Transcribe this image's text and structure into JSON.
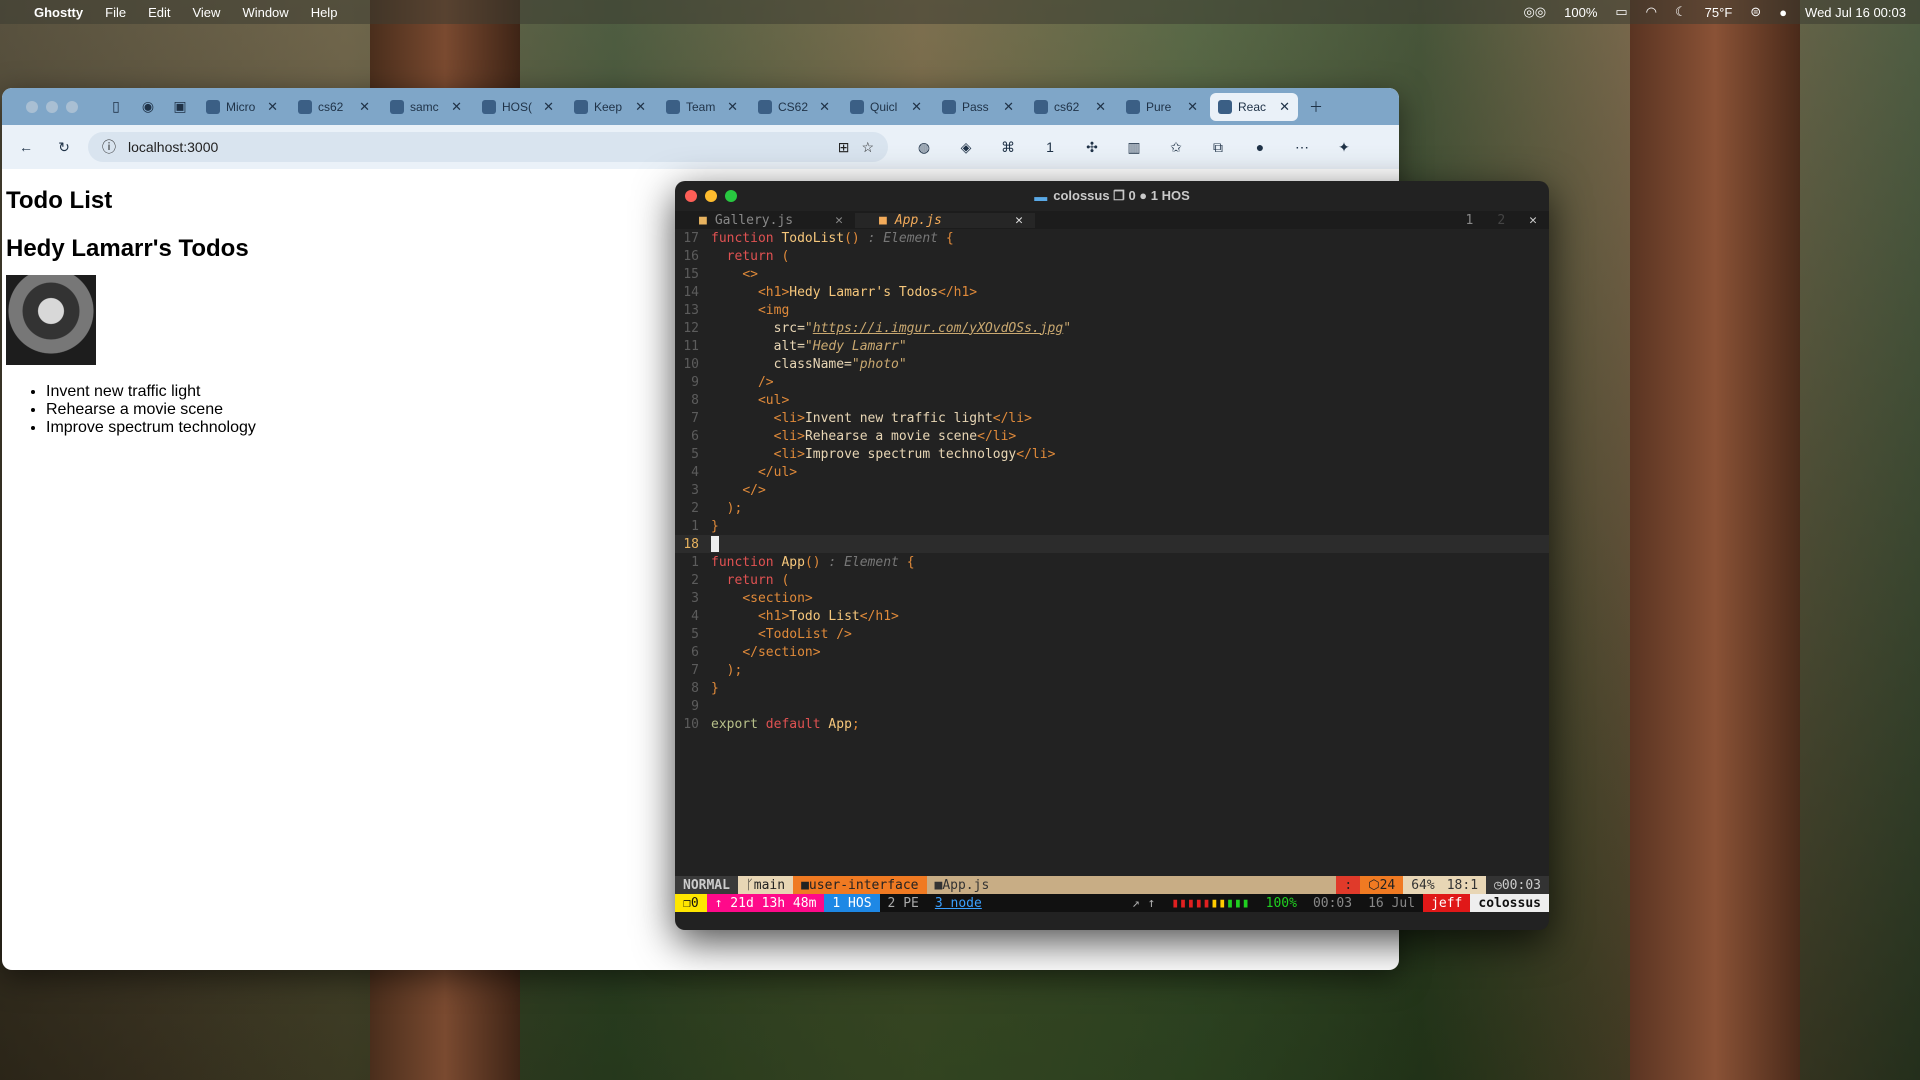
{
  "menubar": {
    "app_name": "Ghostty",
    "menus": [
      "File",
      "Edit",
      "View",
      "Window",
      "Help"
    ],
    "battery": "100%",
    "weather": "75°F",
    "datetime": "Wed Jul 16  00:03"
  },
  "browser": {
    "tabs": [
      {
        "label": "Micro"
      },
      {
        "label": "cs62"
      },
      {
        "label": "samc"
      },
      {
        "label": "HOS("
      },
      {
        "label": "Keep"
      },
      {
        "label": "Team"
      },
      {
        "label": "CS62"
      },
      {
        "label": "Quicl"
      },
      {
        "label": "Pass"
      },
      {
        "label": "cs62"
      },
      {
        "label": "Pure"
      },
      {
        "label": "Reac"
      }
    ],
    "url": "localhost:3000",
    "extension_badge": "1"
  },
  "page": {
    "title": "Todo List",
    "subtitle": "Hedy Lamarr's Todos",
    "image_alt": "Hedy Lamarr",
    "todos": [
      "Invent new traffic light",
      "Rehearse a movie scene",
      "Improve spectrum technology"
    ]
  },
  "terminal": {
    "title": "colossus ❐ 0 ● 1 HOS",
    "buffers": [
      {
        "label": "Gallery.js"
      },
      {
        "label": "App.js"
      }
    ],
    "buffer_nums": [
      "1",
      "2"
    ],
    "status": {
      "mode": "NORMAL",
      "branch": "main",
      "dir": "user-interface",
      "file": "App.js",
      "lsp": "24",
      "percent": "64%",
      "position": "18:1",
      "time": "00:03"
    },
    "tmux": {
      "session": "0",
      "uptime": "↑ 21d 13h 48m",
      "win1": "1 HOS",
      "win2": "2 PE",
      "win3": "3 node",
      "battery": "100%",
      "time": "00:03",
      "date": "16 Jul",
      "user": "jeff",
      "host": "colossus"
    }
  }
}
